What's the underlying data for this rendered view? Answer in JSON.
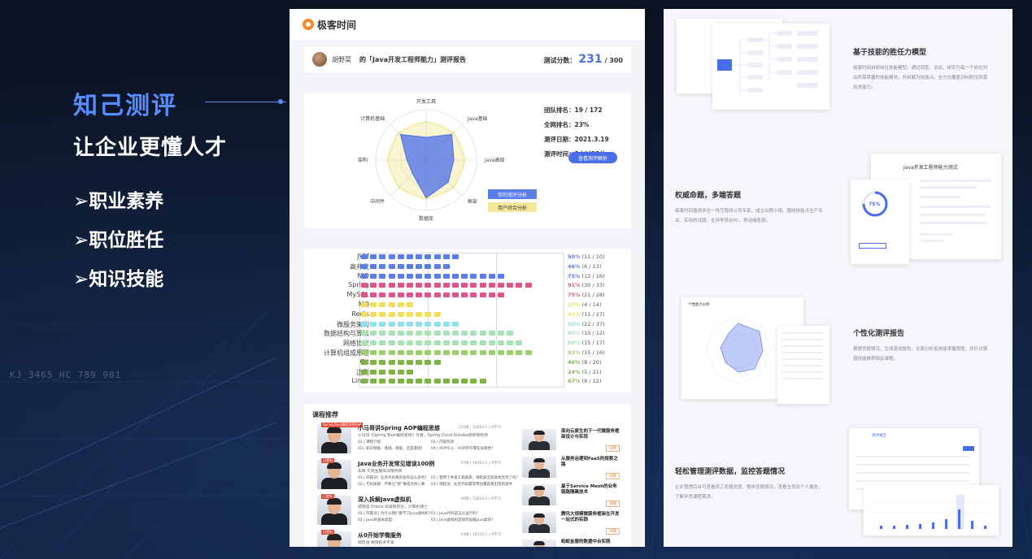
{
  "left": {
    "title": "知己测评",
    "subtitle": "让企业更懂人才",
    "bullets": [
      "➢职业素养",
      "➢职位胜任",
      "➢知识技能"
    ],
    "watermark": "KJ_3465_HC  789    901"
  },
  "report": {
    "logo": "极客时间",
    "user": "胡野菜",
    "title": "的「Java开发工程师能力」测评报告",
    "score_label": "测试分数：",
    "score": "231",
    "score_total": "/ 300",
    "stats": [
      "团队排名：19 / 172",
      "全网排名：23%",
      "测评日期：2021.3.19",
      "测评时间：3小时28分"
    ],
    "report_button": "查看测评解析",
    "legend": [
      "你的测评分析",
      "用户综合分析"
    ],
    "radar": {
      "axes": [
        "开发工具",
        "Java基础",
        "Java高级",
        "框架",
        "数据库",
        "中间件",
        "架构",
        "计算机基础"
      ],
      "values": [
        0.45,
        0.72,
        0.55,
        0.62,
        0.75,
        0.38,
        0.38,
        0.72
      ]
    },
    "skills": [
      {
        "name": "JVM",
        "pct": "50%",
        "count": "(11 / 10)",
        "filled": 11,
        "color": "#5b7de9"
      },
      {
        "name": "高并发",
        "pct": "46%",
        "count": "(6 / 13)",
        "filled": 10,
        "color": "#5b7de9"
      },
      {
        "name": "NIO",
        "pct": "75%",
        "count": "(12 / 16)",
        "filled": 16,
        "color": "#5b7de9"
      },
      {
        "name": "Spring",
        "pct": "91%",
        "count": "(30 / 33)",
        "filled": 19,
        "color": "#e0528a"
      },
      {
        "name": "MySQL",
        "pct": "75%",
        "count": "(21 / 28)",
        "filled": 16,
        "color": "#e0528a"
      },
      {
        "name": "MQ",
        "pct": "20%",
        "count": "(4 / 14)",
        "filled": 6,
        "color": "#f3de5c"
      },
      {
        "name": "Redis",
        "pct": "41%",
        "count": "(11 / 27)",
        "filled": 9,
        "color": "#f3de5c"
      },
      {
        "name": "微服务架构",
        "pct": "50%",
        "count": "(22 / 37)",
        "filled": 11,
        "color": "#8de1ee"
      },
      {
        "name": "数据结构与算法",
        "pct": "83%",
        "count": "(10 / 12)",
        "filled": 17,
        "color": "#a6e3b4"
      },
      {
        "name": "网络协议",
        "pct": "88%",
        "count": "(15 / 17)",
        "filled": 18,
        "color": "#a6e3b4"
      },
      {
        "name": "计算机组成原理",
        "pct": "93%",
        "count": "(15 / 16)",
        "filled": 19,
        "color": "#9ccf6a"
      },
      {
        "name": "Git",
        "pct": "40%",
        "count": "(8 / 20)",
        "filled": 9,
        "color": "#7cb342"
      },
      {
        "name": "正则",
        "pct": "24%",
        "count": "(5 / 21)",
        "filled": 6,
        "color": "#7cb342"
      },
      {
        "name": "Linux",
        "pct": "67%",
        "count": "(8 / 12)",
        "filled": 14,
        "color": "#7cb342"
      }
    ],
    "course_header": "课程推荐",
    "courses": [
      {
        "title": "小马哥讲Spring AOP编程思想",
        "meta": "115讲 | 33054人 | ¥学习",
        "desc": "小马哥《Spring Boot编程思想》作者，Spring Cloud Alibaba项目架构师",
        "tag": "Spring Boot编程思想作者",
        "ch1": "01 | 课程介绍",
        "ch2": "02 | 内容综述",
        "ch3": "03 | 知识储备：基础、基础，还是基础！",
        "ch4": "04 | AOP引入：OOP存在哪些局限性？"
      },
      {
        "title": "Java业务开发常见错误100例",
        "meta": "47讲 | 19591人 | ¥学习",
        "desc": "朱晔 贝壳金服资深架构师",
        "tag": "已更新",
        "ch1": "01 | 开篇词：业务代码真的会有这么多坑？",
        "ch2": "01 | 使用了并发工具类库，线程安全就高枕无忧了吗？",
        "ch3": "02 | 代码加锁：不要让“锁”事成为烦心事",
        "ch4": "03 | 线程池：业务代码最常用也最容易犯错的组件"
      },
      {
        "title": "深入拆解Java虚拟机",
        "meta": "40讲 | 23615人 | ¥学习",
        "desc": "郑雨迪 Oracle 高级研究员，计算机博士",
        "tag": "已更新",
        "ch1": "01 | 开篇词 | 为什么我们要学习Java虚拟机？",
        "ch2": "01 | Java代码是怎么运行的？",
        "ch3": "02 | Java的基本类型",
        "ch4": "03 | Java虚拟机是如何加载Java类的？"
      },
      {
        "title": "从0开始学微服务",
        "meta": "43讲 | 16555人 | ¥学习",
        "desc": "胡忠想 微博技术专家",
        "tag": "已更新",
        "ch1": "",
        "ch2": "",
        "ch3": "",
        "ch4": ""
      }
    ],
    "side_courses": [
      {
        "title": "面向云原生的下一代微服务框架设计与实现",
        "btn": "试看"
      },
      {
        "title": "从服务治理到FaaS的探索之路",
        "btn": "试看"
      },
      {
        "title": "基于Service Mesh的业务链路隔离技术",
        "btn": "试看"
      },
      {
        "title": "腾讯大规模微服务框架在开发一站式的实践",
        "btn": "试看"
      },
      {
        "title": "蚂蚁金服的数据中台实践",
        "btn": "试看"
      }
    ]
  },
  "features": [
    {
      "title": "基于技能的胜任力模型",
      "text": [
        "极客时间自研岗位技能模型。通过调查、访谈、研究为每一个岗位列",
        "出所需掌握的技能模块，并拆解为技能点。全方位覆盖目标职位所需",
        "技术能力。"
      ]
    },
    {
      "title": "权威命题，多端答题",
      "text": [
        "极客时间邀请多位一线互联网公司专家，成立出题小组。围绕技能点生产专",
        "业、实用的试题。支持学员在PC、移动端答题。"
      ]
    },
    {
      "title": "个性化测评报告",
      "text": [
        "根据答题情况，生成测试报告。全面分析各技能掌握程度，并针对薄",
        "弱技能推荐相关课程。"
      ]
    },
    {
      "title": "轻松管理测评数据，监控答题情况",
      "text": [
        "企业管理后台可查看员工答题进度、整体答题情况，查看全员及个人报告，",
        "了解学员课程需求。"
      ]
    }
  ],
  "mock_texts": {
    "quiz_title": "Java开发工程师能力测试",
    "quiz_pct": "75%",
    "radar_title": "个性能力分析",
    "admin_title": "测评报告"
  }
}
